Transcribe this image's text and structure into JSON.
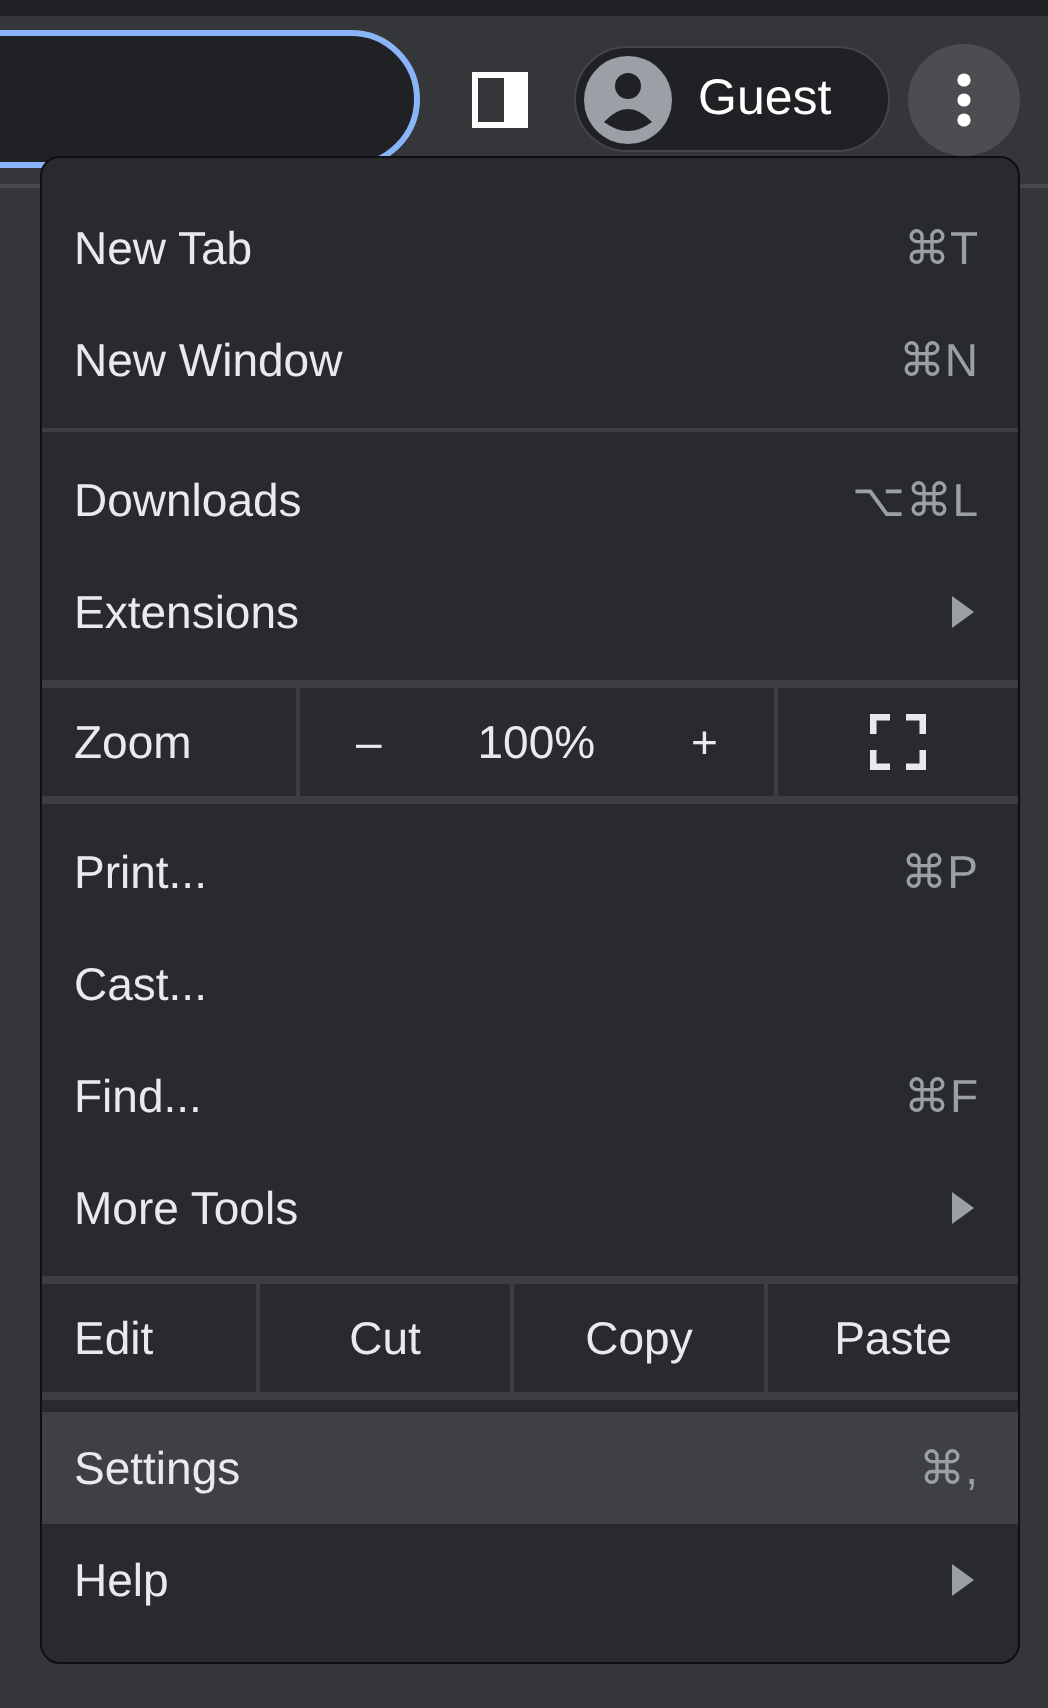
{
  "toolbar": {
    "profile": {
      "name": "Guest"
    }
  },
  "menu": {
    "groups": [
      [
        {
          "kind": "item",
          "label": "New Tab",
          "shortcut": "⌘T",
          "submenu": false,
          "selected": false
        },
        {
          "kind": "item",
          "label": "New Window",
          "shortcut": "⌘N",
          "submenu": false,
          "selected": false
        }
      ],
      [
        {
          "kind": "item",
          "label": "Downloads",
          "shortcut": "⌥⌘L",
          "submenu": false,
          "selected": false
        },
        {
          "kind": "item",
          "label": "Extensions",
          "submenu": true,
          "selected": false
        }
      ],
      [
        {
          "kind": "zoom",
          "label": "Zoom",
          "minus": "–",
          "value": "100%",
          "plus": "+"
        }
      ],
      [
        {
          "kind": "item",
          "label": "Print...",
          "shortcut": "⌘P",
          "submenu": false,
          "selected": false
        },
        {
          "kind": "item",
          "label": "Cast...",
          "submenu": false,
          "selected": false
        },
        {
          "kind": "item",
          "label": "Find...",
          "shortcut": "⌘F",
          "submenu": false,
          "selected": false
        },
        {
          "kind": "item",
          "label": "More Tools",
          "submenu": true,
          "selected": false
        }
      ],
      [
        {
          "kind": "edit",
          "label": "Edit",
          "actions": [
            "Cut",
            "Copy",
            "Paste"
          ]
        }
      ],
      [
        {
          "kind": "item",
          "label": "Settings",
          "shortcut": "⌘,",
          "submenu": false,
          "selected": true
        },
        {
          "kind": "item",
          "label": "Help",
          "submenu": true,
          "selected": false
        }
      ]
    ]
  }
}
